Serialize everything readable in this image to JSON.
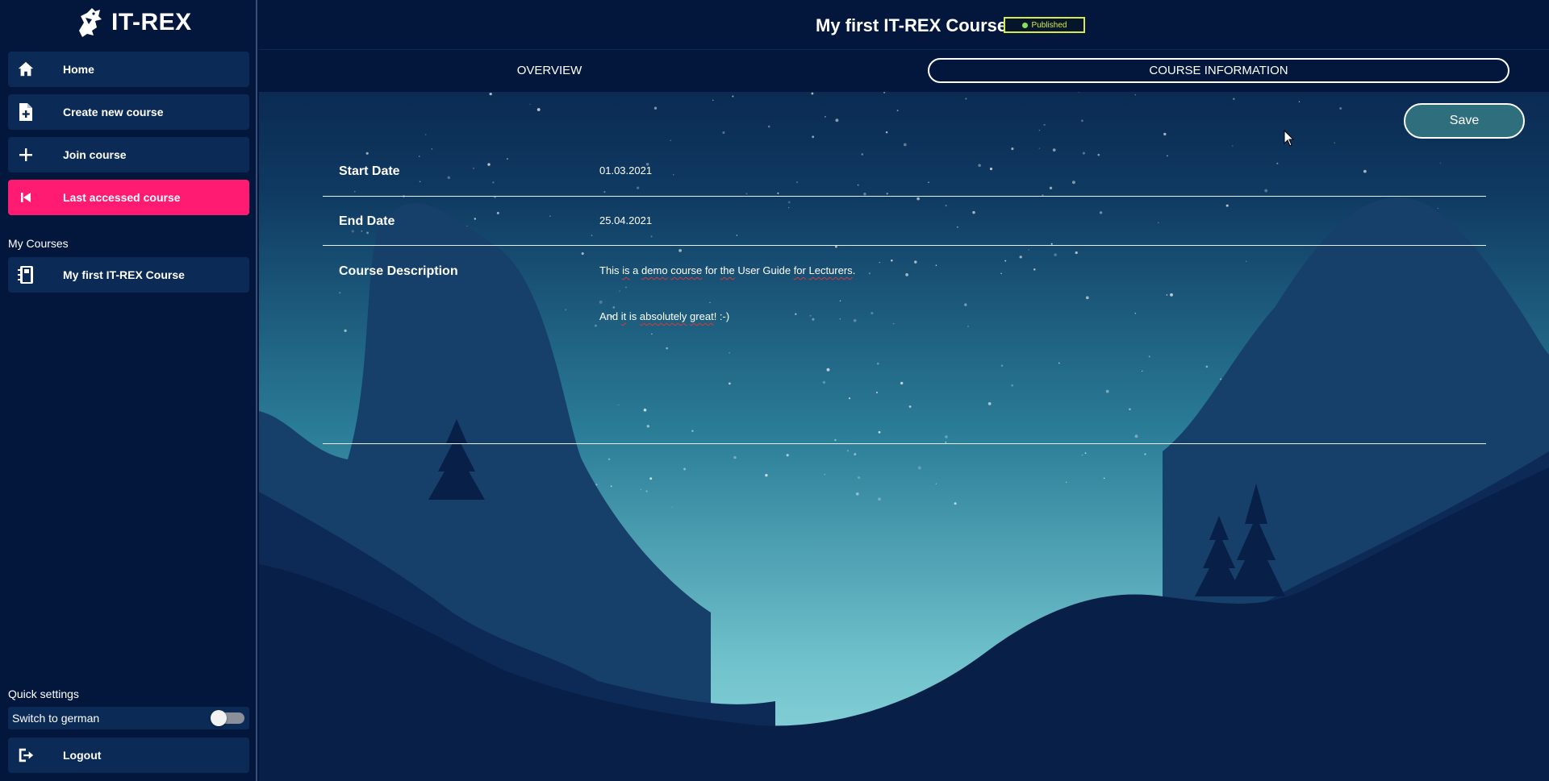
{
  "app": {
    "name": "IT-REX"
  },
  "sidebar": {
    "nav": [
      {
        "label": "Home",
        "icon": "home-icon",
        "active": false
      },
      {
        "label": "Create new course",
        "icon": "file-plus-icon",
        "active": false
      },
      {
        "label": "Join course",
        "icon": "plus-icon",
        "active": false
      },
      {
        "label": "Last accessed course",
        "icon": "skip-back-icon",
        "active": true
      }
    ],
    "my_courses_label": "My Courses",
    "courses": [
      {
        "label": "My first IT-REX Course",
        "icon": "notebook-icon"
      }
    ],
    "quick_settings_label": "Quick settings",
    "language_toggle": {
      "label": "Switch to german",
      "on": false
    },
    "logout": {
      "label": "Logout",
      "icon": "logout-icon"
    }
  },
  "header": {
    "course_title": "My first IT-REX Course",
    "status": "Published"
  },
  "tabs": [
    {
      "label": "OVERVIEW",
      "selected": false
    },
    {
      "label": "COURSE INFORMATION",
      "selected": true
    }
  ],
  "actions": {
    "save_label": "Save"
  },
  "course_info": {
    "start_date_label": "Start Date",
    "start_date": "01.03.2021",
    "end_date_label": "End Date",
    "end_date": "25.04.2021",
    "description_label": "Course Description",
    "description": {
      "line1_parts": [
        "This ",
        "is",
        " a ",
        "demo",
        " ",
        "course",
        " for ",
        "the",
        " User Guide ",
        "for",
        " ",
        "Lecturers",
        "."
      ],
      "line2_parts": [
        "And ",
        "it",
        " is ",
        "absolutely",
        " ",
        "great",
        "! :-)"
      ]
    }
  },
  "colors": {
    "background": "#03173d",
    "nav_item": "#0b2a55",
    "active_nav": "#ff1b72",
    "badge_border": "#d7e84a",
    "save_button": "#2f6f7d"
  }
}
